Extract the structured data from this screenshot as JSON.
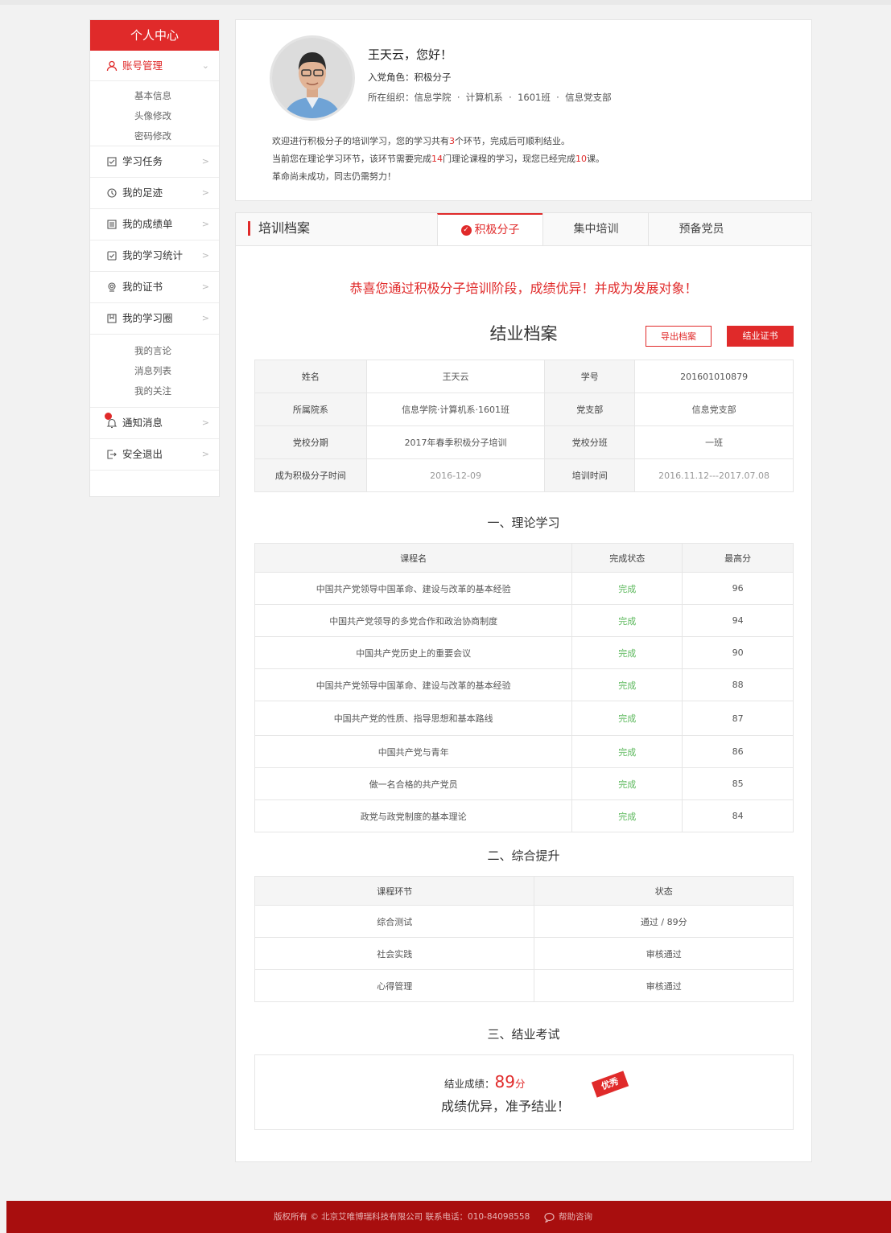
{
  "sidebar": {
    "title": "个人中心",
    "account": {
      "label": "账号管理",
      "sub": [
        "基本信息",
        "头像修改",
        "密码修改"
      ]
    },
    "items": [
      {
        "label": "学习任务",
        "icon": "task-icon"
      },
      {
        "label": "我的足迹",
        "icon": "history-icon"
      },
      {
        "label": "我的成绩单",
        "icon": "report-icon"
      },
      {
        "label": "我的学习统计",
        "icon": "checkbox-icon"
      },
      {
        "label": "我的证书",
        "icon": "certificate-icon"
      },
      {
        "label": "我的学习圈",
        "icon": "circle-icon"
      }
    ],
    "circle_sub": [
      "我的言论",
      "消息列表",
      "我的关注"
    ],
    "notify": "通知消息",
    "logout": "安全退出"
  },
  "profile": {
    "greeting": "王天云，您好！",
    "role_label": "入党角色：",
    "role": "积极分子",
    "org_label": "所在组织：",
    "org": [
      "信息学院",
      "计算机系",
      "1601班",
      "信息党支部"
    ],
    "org_sep": "·",
    "line1_a": "欢迎进行积极分子的培训学习，您的学习共有",
    "line1_n": "3",
    "line1_b": "个环节，完成后可顺利结业。",
    "line2_a": "当前您在理论学习环节，该环节需要完成",
    "line2_n1": "14",
    "line2_b": "门理论课程的学习，现您已经完成",
    "line2_n2": "10",
    "line2_c": "课。",
    "line3": "革命尚未成功，同志仍需努力！"
  },
  "tabs": {
    "title": "培训档案",
    "items": [
      "积极分子",
      "集中培训",
      "预备党员"
    ]
  },
  "record": {
    "congrats": "恭喜您通过积极分子培训阶段，成绩优异！并成为发展对象！",
    "title": "结业档案",
    "export_btn": "导出档案",
    "cert_btn": "结业证书",
    "info": [
      [
        "姓名",
        "王天云",
        "学号",
        "201601010879"
      ],
      [
        "所属院系",
        "信息学院·计算机系·1601班",
        "党支部",
        "信息党支部"
      ],
      [
        "党校分期",
        "2017年春季积极分子培训",
        "党校分班",
        "一班"
      ],
      [
        "成为积极分子时间",
        "2016-12-09",
        "培训时间",
        "2016.11.12---2017.07.08"
      ]
    ]
  },
  "theory": {
    "title": "一、理论学习",
    "headers": [
      "课程名",
      "完成状态",
      "最高分"
    ],
    "rows": [
      [
        "中国共产党领导中国革命、建设与改革的基本经验",
        "完成",
        "96"
      ],
      [
        "中国共产党领导的多党合作和政治协商制度",
        "完成",
        "94"
      ],
      [
        "中国共产党历史上的重要会议",
        "完成",
        "90"
      ],
      [
        "中国共产党领导中国革命、建设与改革的基本经验",
        "完成",
        "88"
      ],
      [
        "中国共产党的性质、指导思想和基本路线",
        "完成",
        "87"
      ],
      [
        "中国共产党与青年",
        "完成",
        "86"
      ],
      [
        "做一名合格的共产党员",
        "完成",
        "85"
      ],
      [
        "政党与政党制度的基本理论",
        "完成",
        "84"
      ]
    ]
  },
  "comprehensive": {
    "title": "二、综合提升",
    "headers": [
      "课程环节",
      "状态"
    ],
    "rows": [
      [
        "综合测试",
        "通过 / 89分"
      ],
      [
        "社会实践",
        "审核通过"
      ],
      [
        "心得管理",
        "审核通过"
      ]
    ]
  },
  "exam": {
    "title": "三、结业考试",
    "score_label": "结业成绩：",
    "score": "89",
    "score_unit": "分",
    "message": "成绩优异，准予结业！",
    "stamp": "优秀"
  },
  "footer": {
    "copyright": "版权所有 © 北京艾唯博瑞科技有限公司  联系电话：010-84098558",
    "help": "帮助咨询"
  },
  "colors": {
    "accent": "#e02a2a",
    "done": "#5cb85c",
    "footer": "#a80e0e"
  }
}
